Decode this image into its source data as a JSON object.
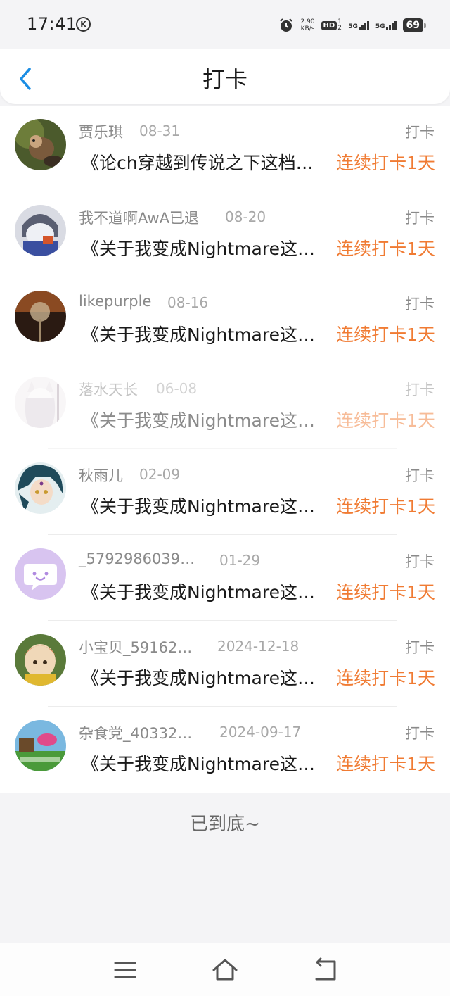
{
  "status_bar": {
    "time": "17:41",
    "k_badge": "K",
    "net_speed_value": "2.90",
    "net_speed_unit": "KB/s",
    "hd_label": "HD",
    "hd_sub": "1 2",
    "signal1": "5G",
    "signal2": "5G",
    "battery": "69"
  },
  "header": {
    "title": "打卡",
    "back_icon": "chevron-left-icon",
    "accent_color": "#1a8de4"
  },
  "streak_color": "#f07b33",
  "checkins": [
    {
      "user": "贾乐琪",
      "date": "08-31",
      "tag": "打卡",
      "book": "《论ch穿越到传说之下这档…",
      "streak": "连续打卡1天"
    },
    {
      "user": "我不道啊AwA已退",
      "date": "08-20",
      "tag": "打卡",
      "book": "《关于我变成Nightmare这…",
      "streak": "连续打卡1天"
    },
    {
      "user": "likepurple",
      "date": "08-16",
      "tag": "打卡",
      "book": "《关于我变成Nightmare这…",
      "streak": "连续打卡1天"
    },
    {
      "user": "落水天长",
      "date": "06-08",
      "tag": "打卡",
      "book": "《关于我变成Nightmare这…",
      "streak": "连续打卡1天"
    },
    {
      "user": "秋雨儿",
      "date": "02-09",
      "tag": "打卡",
      "book": "《关于我变成Nightmare这…",
      "streak": "连续打卡1天"
    },
    {
      "user": "_5792986039…",
      "date": "01-29",
      "tag": "打卡",
      "book": "《关于我变成Nightmare这…",
      "streak": "连续打卡1天"
    },
    {
      "user": "小宝贝_59162…",
      "date": "2024-12-18",
      "tag": "打卡",
      "book": "《关于我变成Nightmare这…",
      "streak": "连续打卡1天"
    },
    {
      "user": "杂食党_40332…",
      "date": "2024-09-17",
      "tag": "打卡",
      "book": "《关于我变成Nightmare这…",
      "streak": "连续打卡1天"
    }
  ],
  "list_end": "已到底~",
  "nav": {
    "menu_icon": "menu-icon",
    "home_icon": "home-icon",
    "back_icon": "back-icon"
  }
}
